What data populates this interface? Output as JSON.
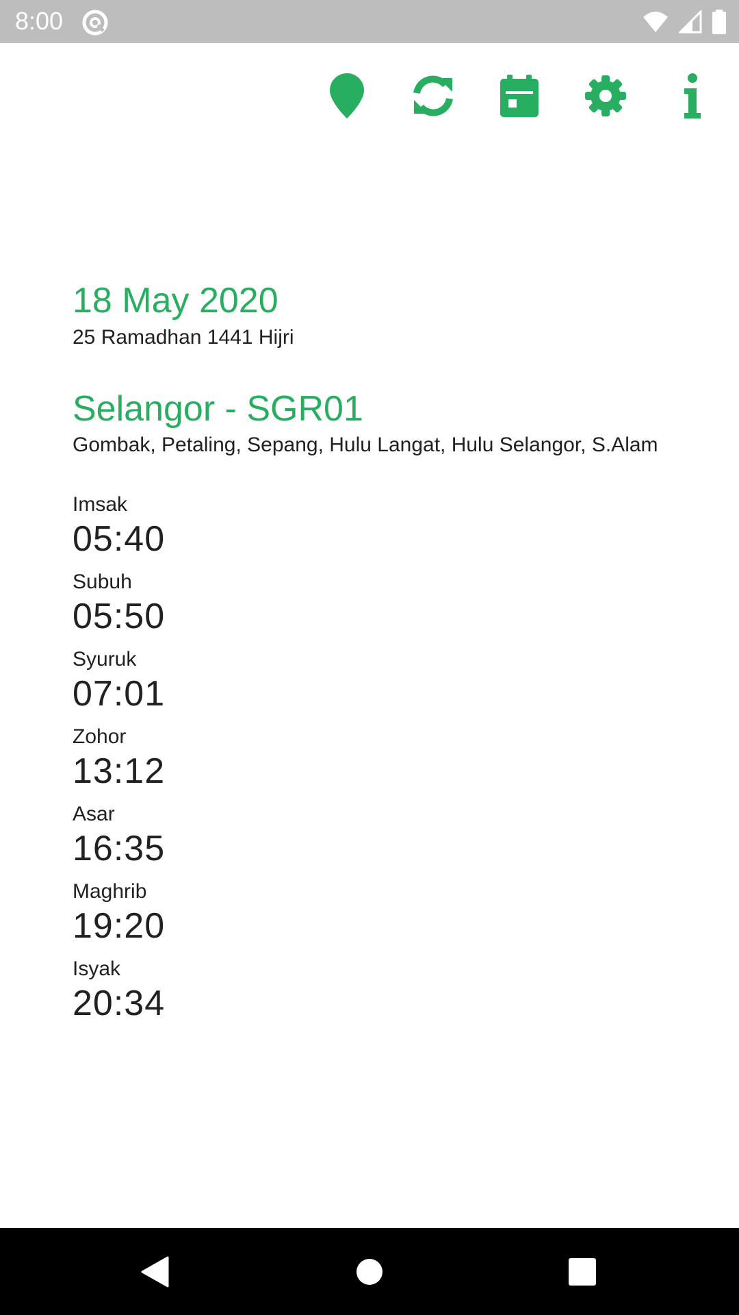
{
  "status_bar": {
    "time": "8:00",
    "icons": [
      "sync-icon",
      "wifi-icon",
      "signal-icon",
      "battery-icon"
    ]
  },
  "toolbar": {
    "accent_color": "#27ae60",
    "buttons": [
      "location-icon",
      "refresh-icon",
      "calendar-icon",
      "settings-icon",
      "info-icon"
    ]
  },
  "main": {
    "date": "18 May 2020",
    "hijri_date": "25 Ramadhan 1441 Hijri",
    "zone_title": "Selangor - SGR01",
    "zone_areas": "Gombak, Petaling, Sepang, Hulu Langat, Hulu Selangor, S.Alam",
    "prayers": [
      {
        "name": "Imsak",
        "time": "05:40"
      },
      {
        "name": "Subuh",
        "time": "05:50"
      },
      {
        "name": "Syuruk",
        "time": "07:01"
      },
      {
        "name": "Zohor",
        "time": "13:12"
      },
      {
        "name": "Asar",
        "time": "16:35"
      },
      {
        "name": "Maghrib",
        "time": "19:20"
      },
      {
        "name": "Isyak",
        "time": "20:34"
      }
    ]
  },
  "nav_bar": {
    "buttons": [
      "back-icon",
      "home-icon",
      "recents-icon"
    ]
  }
}
